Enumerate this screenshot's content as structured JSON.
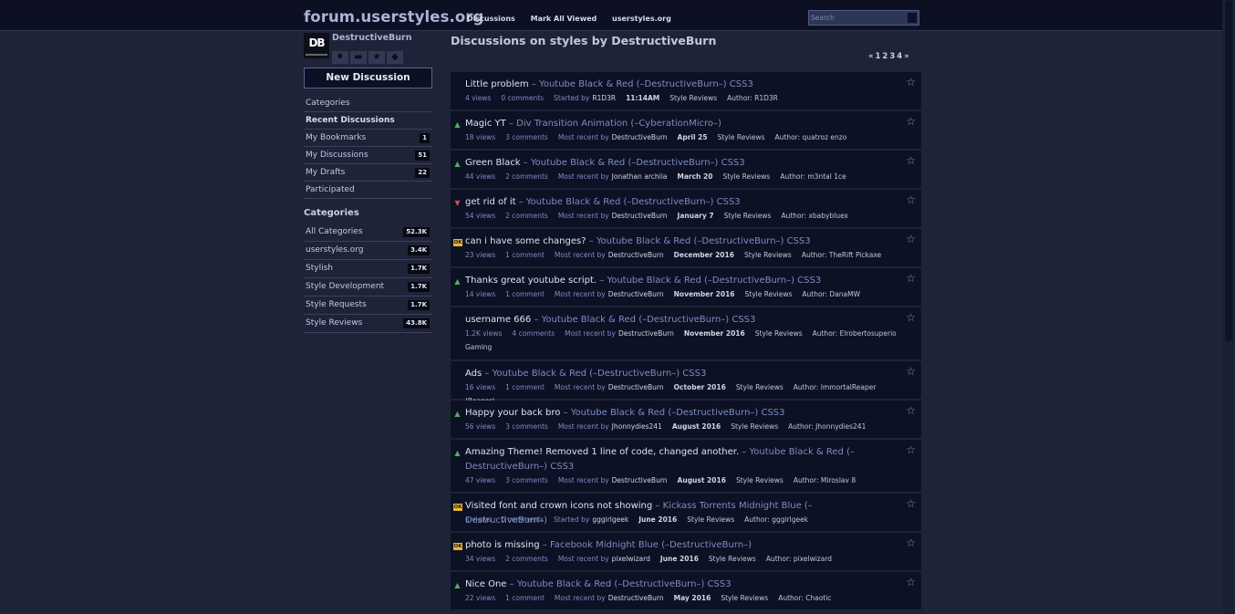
{
  "header": {
    "site_title": "forum.userstyles.org",
    "nav": [
      "Discussions",
      "Mark All Viewed",
      "userstyles.org"
    ],
    "search_placeholder": "Search"
  },
  "sidebar": {
    "avatar_text": "DB",
    "username": "DestructiveBurn",
    "new_discussion": "New Discussion",
    "menu": [
      {
        "label": "Categories",
        "count": ""
      },
      {
        "label": "Recent Discussions",
        "count": ""
      },
      {
        "label": "My Bookmarks",
        "count": "1"
      },
      {
        "label": "My Discussions",
        "count": "51"
      },
      {
        "label": "My Drafts",
        "count": "22"
      },
      {
        "label": "Participated",
        "count": ""
      }
    ],
    "categories_heading": "Categories",
    "categories": [
      {
        "label": "All Categories",
        "count": "52.3K"
      },
      {
        "label": "userstyles.org",
        "count": "3.4K"
      },
      {
        "label": "Stylish",
        "count": "1.7K"
      },
      {
        "label": "Style Development",
        "count": "1.7K"
      },
      {
        "label": "Style Requests",
        "count": "1.7K"
      },
      {
        "label": "Style Reviews",
        "count": "43.8K"
      }
    ]
  },
  "main": {
    "page_title": "Discussions on styles by DestructiveBurn",
    "pager": [
      "«",
      "1",
      "2",
      "3",
      "4",
      "»"
    ],
    "discussions": [
      {
        "vote": "none",
        "title": "Little problem",
        "sep": " – ",
        "style": "Youtube Black & Red (–DestructiveBurn–) CSS3",
        "views": "4 views",
        "comments": "0 comments",
        "who_label": "Started by",
        "who": "R1D3R",
        "date": "11:14AM",
        "cat": "Style Reviews",
        "author": "Author: R1D3R"
      },
      {
        "vote": "up",
        "title": "Magic YT",
        "sep": " – ",
        "style": "Div Transition Animation (–CyberationMicro–)",
        "views": "18 views",
        "comments": "3 comments",
        "who_label": "Most recent by",
        "who": "DestructiveBurn",
        "date": "April 25",
        "cat": "Style Reviews",
        "author": "Author: quatroz enzo"
      },
      {
        "vote": "up",
        "title": "Green Black",
        "sep": " – ",
        "style": "Youtube Black & Red (–DestructiveBurn–) CSS3",
        "views": "44 views",
        "comments": "2 comments",
        "who_label": "Most recent by",
        "who": "Jonathan archila",
        "date": "March 20",
        "cat": "Style Reviews",
        "author": "Author: m3ntal 1ce"
      },
      {
        "vote": "down",
        "title": "get rid of it",
        "sep": " – ",
        "style": "Youtube Black & Red (–DestructiveBurn–) CSS3",
        "views": "54 views",
        "comments": "2 comments",
        "who_label": "Most recent by",
        "who": "DestructiveBurn",
        "date": "January 7",
        "cat": "Style Reviews",
        "author": "Author: xbabybluex"
      },
      {
        "vote": "ok",
        "title": "can i have some changes?",
        "sep": " – ",
        "style": "Youtube Black & Red (–DestructiveBurn–) CSS3",
        "views": "23 views",
        "comments": "1 comment",
        "who_label": "Most recent by",
        "who": "DestructiveBurn",
        "date": "December 2016",
        "cat": "Style Reviews",
        "author": "Author: TheRift Pickaxe"
      },
      {
        "vote": "up",
        "title": "Thanks great youtube script.",
        "sep": " – ",
        "style": "Youtube Black & Red (–DestructiveBurn–) CSS3",
        "views": "14 views",
        "comments": "1 comment",
        "who_label": "Most recent by",
        "who": "DestructiveBurn",
        "date": "November 2016",
        "cat": "Style Reviews",
        "author": "Author: DanaMW"
      },
      {
        "vote": "none",
        "title": "username 666",
        "sep": " – ",
        "style": "Youtube Black & Red (–DestructiveBurn–) CSS3",
        "views": "1.2K views",
        "comments": "4 comments",
        "who_label": "Most recent by",
        "who": "DestructiveBurn",
        "date": "November 2016",
        "cat": "Style Reviews",
        "author": "Author: Elrobertosuperio Gaming"
      },
      {
        "vote": "none",
        "title": "Ads",
        "sep": " – ",
        "style": "Youtube Black & Red (–DestructiveBurn–) CSS3",
        "views": "16 views",
        "comments": "1 comment",
        "who_label": "Most recent by",
        "who": "DestructiveBurn",
        "date": "October 2016",
        "cat": "Style Reviews",
        "author": "Author: ImmortalReaper (Reaper)"
      },
      {
        "vote": "up",
        "title": "Happy your back bro",
        "sep": " – ",
        "style": "Youtube Black & Red (–DestructiveBurn–) CSS3",
        "views": "56 views",
        "comments": "3 comments",
        "who_label": "Most recent by",
        "who": "Jhonnydies241",
        "date": "August 2016",
        "cat": "Style Reviews",
        "author": "Author: Jhonnydies241"
      },
      {
        "vote": "up",
        "title": "Amazing Theme! Removed 1 line of code, changed another.",
        "sep": " – ",
        "style": "Youtube Black & Red (–DestructiveBurn–) CSS3",
        "views": "47 views",
        "comments": "3 comments",
        "who_label": "Most recent by",
        "who": "DestructiveBurn",
        "date": "August 2016",
        "cat": "Style Reviews",
        "author": "Author: Miroslav 8"
      },
      {
        "vote": "ok",
        "title": "Visited font and crown icons not showing",
        "sep": " – ",
        "style": "Kickass Torrents Midnight Blue (–DestructiveBurn–)",
        "views": "6 views",
        "comments": "0 comments",
        "who_label": "Started by",
        "who": "gggirlgeek",
        "date": "June 2016",
        "cat": "Style Reviews",
        "author": "Author: gggirlgeek"
      },
      {
        "vote": "ok",
        "title": "photo is missing",
        "sep": " – ",
        "style": "Facebook Midnight Blue (–DestructiveBurn–)",
        "views": "34 views",
        "comments": "2 comments",
        "who_label": "Most recent by",
        "who": "pixelwizard",
        "date": "June 2016",
        "cat": "Style Reviews",
        "author": "Author: pixelwizard"
      },
      {
        "vote": "up",
        "title": "Nice One",
        "sep": " – ",
        "style": "Youtube Black & Red (–DestructiveBurn–) CSS3",
        "views": "22 views",
        "comments": "1 comment",
        "who_label": "Most recent by",
        "who": "DestructiveBurn",
        "date": "May 2016",
        "cat": "Style Reviews",
        "author": "Author: Chaotic"
      }
    ]
  }
}
